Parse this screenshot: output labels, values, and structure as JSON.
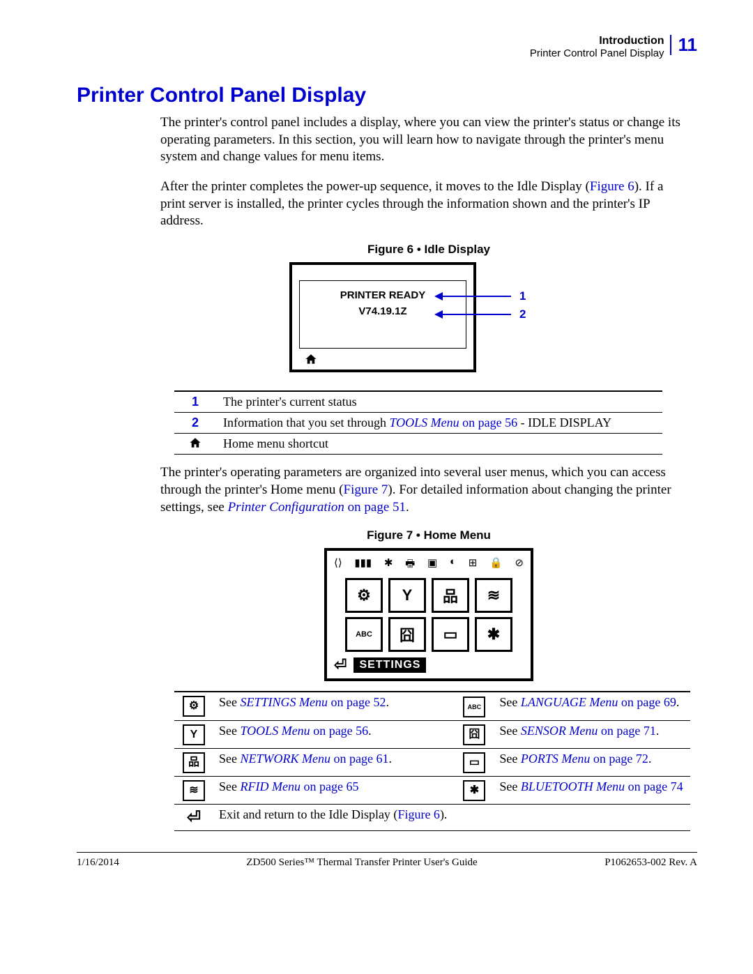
{
  "header": {
    "intro": "Introduction",
    "subtitle": "Printer Control Panel Display",
    "page_number": "11"
  },
  "title": "Printer Control Panel Display",
  "para1": "The printer's control panel includes a display, where you can view the printer's status or change its operating parameters. In this section, you will learn how to navigate through the printer's menu system and change values for menu items.",
  "para2_a": "After the printer completes the power-up sequence, it moves to the Idle Display (",
  "para2_link": "Figure 6",
  "para2_b": "). If a print server is installed, the printer cycles through the information shown and the printer's IP address.",
  "figure6": {
    "caption": "Figure 6 • Idle Display",
    "line1": "PRINTER READY",
    "line2": "V74.19.1Z",
    "callout1": "1",
    "callout2": "2"
  },
  "callout_table": {
    "r1_num": "1",
    "r1_text": "The printer's current status",
    "r2_num": "2",
    "r2_a": "Information that you set through ",
    "r2_link": "TOOLS Menu",
    "r2_page": " on page 56",
    "r2_b": " - IDLE DISPLAY",
    "r3_text": "Home menu shortcut"
  },
  "para3_a": "The printer's operating parameters are organized into several user menus, which you can access through the printer's Home menu (",
  "para3_link1": "Figure 7",
  "para3_b": "). For detailed information about changing the printer settings, see ",
  "para3_link2": "Printer Configuration",
  "para3_page": " on page 51",
  "para3_c": ".",
  "figure7": {
    "caption": "Figure 7 • Home Menu",
    "settings_label": "SETTINGS"
  },
  "menu_refs": {
    "left": [
      {
        "icon": "gear-icon",
        "glyph": "⚙",
        "text_a": "See ",
        "link": "SETTINGS Menu",
        "page": " on page 52",
        "text_b": "."
      },
      {
        "icon": "tools-icon",
        "glyph": "Y",
        "text_a": "See ",
        "link": "TOOLS Menu",
        "page": " on page 56",
        "text_b": "."
      },
      {
        "icon": "network-icon",
        "glyph": "品",
        "text_a": "See ",
        "link": "NETWORK Menu",
        "page": " on page 61",
        "text_b": "."
      },
      {
        "icon": "rfid-icon",
        "glyph": "≋",
        "text_a": "See ",
        "link": "RFID Menu",
        "page": " on page 65",
        "text_b": ""
      },
      {
        "icon": "exit-icon",
        "glyph": "⏎",
        "text_a": "Exit and return to the Idle Display (",
        "link": "Figure 6",
        "page": "",
        "text_b": ")."
      }
    ],
    "right": [
      {
        "icon": "language-icon",
        "glyph": "ABC",
        "text_a": "See ",
        "link": "LANGUAGE Menu",
        "page": " on page 69",
        "text_b": "."
      },
      {
        "icon": "sensor-icon",
        "glyph": "囧",
        "text_a": "See ",
        "link": "SENSOR Menu",
        "page": " on page 71",
        "text_b": "."
      },
      {
        "icon": "ports-icon",
        "glyph": "▭",
        "text_a": "See ",
        "link": "PORTS Menu",
        "page": " on page 72",
        "text_b": "."
      },
      {
        "icon": "bluetooth-icon",
        "glyph": "✱",
        "text_a": "See ",
        "link": "BLUETOOTH Menu",
        "page": " on page 74",
        "text_b": ""
      }
    ]
  },
  "footer": {
    "date": "1/16/2014",
    "center": "ZD500 Series™ Thermal Transfer Printer User's Guide",
    "right": "P1062653-002 Rev. A"
  }
}
